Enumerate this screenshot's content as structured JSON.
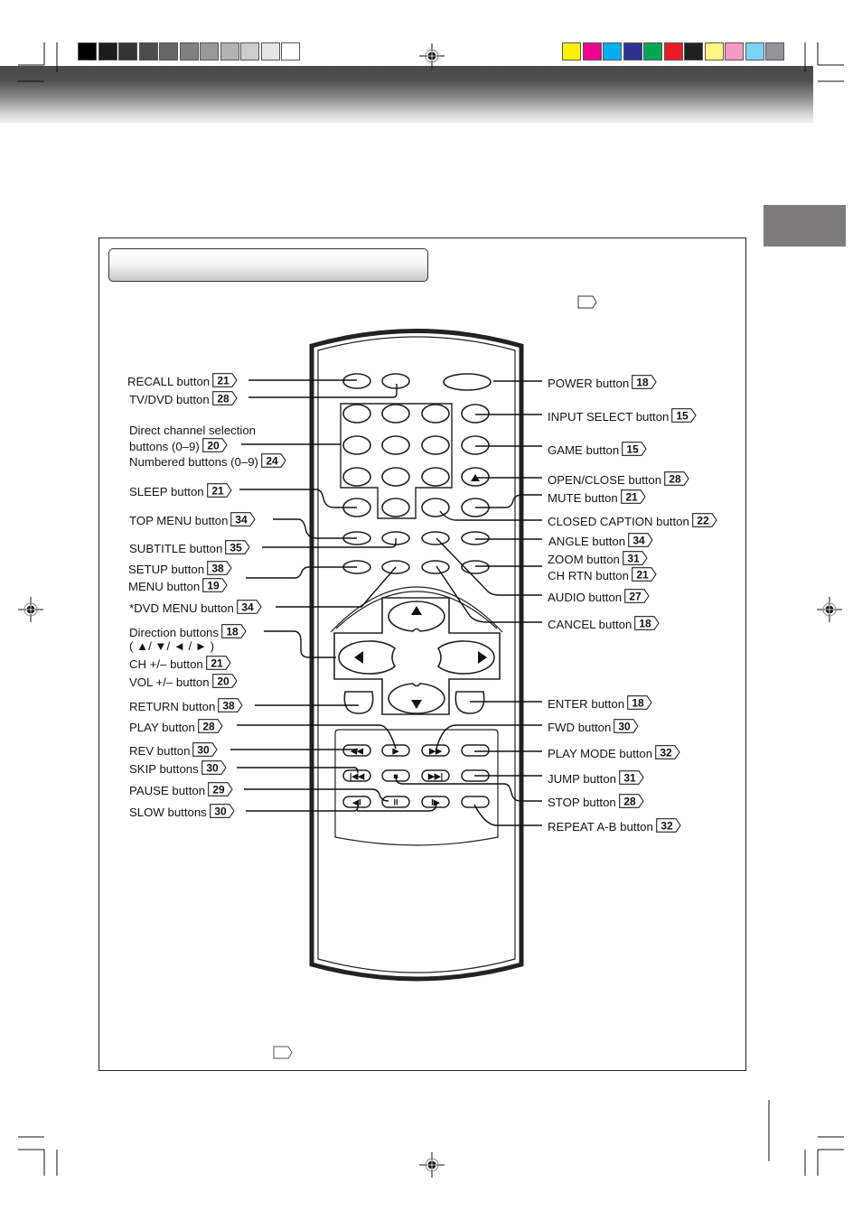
{
  "page": {
    "color_bar_gray": [
      "#000000",
      "#1c1c1c",
      "#353535",
      "#4d4d4d",
      "#666666",
      "#808080",
      "#999999",
      "#b3b3b3",
      "#cccccc",
      "#e6e6e6",
      "#ffffff"
    ],
    "color_bar_color": [
      "#fff200",
      "#ec008c",
      "#00aeef",
      "#2e3192",
      "#00a651",
      "#ed1c24",
      "#231f20",
      "#fff582",
      "#f49ac1",
      "#7dd3f7",
      "#939598"
    ],
    "side_tab_color": "#7d7b7b"
  },
  "labels_left": [
    {
      "id": "recall",
      "text": "RECALL button",
      "page": "21"
    },
    {
      "id": "tvdvd",
      "text": "TV/DVD button",
      "page": "28"
    },
    {
      "id": "direct1",
      "text": "Direct channel selection",
      "page": null
    },
    {
      "id": "direct2",
      "text": "buttons (0–9)",
      "page": "20"
    },
    {
      "id": "numbered",
      "text": "Numbered buttons (0–9)",
      "page": "24"
    },
    {
      "id": "sleep",
      "text": "SLEEP button",
      "page": "21"
    },
    {
      "id": "topmenu",
      "text": "TOP MENU button",
      "page": "34"
    },
    {
      "id": "subtitle",
      "text": "SUBTITLE button",
      "page": "35"
    },
    {
      "id": "setup",
      "text": "SETUP button",
      "page": "38"
    },
    {
      "id": "menu",
      "text": "MENU button",
      "page": "19"
    },
    {
      "id": "dvdmenu",
      "text": "*DVD MENU button",
      "page": "34"
    },
    {
      "id": "direction",
      "text": "Direction buttons",
      "page": "18"
    },
    {
      "id": "arrows",
      "text": "( ▲/ ▼/ ◄ / ► )",
      "page": null
    },
    {
      "id": "ch",
      "text": "CH +/– button",
      "page": "21"
    },
    {
      "id": "vol",
      "text": "VOL +/– button",
      "page": "20"
    },
    {
      "id": "return",
      "text": "RETURN button",
      "page": "38"
    },
    {
      "id": "play",
      "text": "PLAY button",
      "page": "28"
    },
    {
      "id": "rev",
      "text": "REV button",
      "page": "30"
    },
    {
      "id": "skip",
      "text": "SKIP buttons",
      "page": "30"
    },
    {
      "id": "pause",
      "text": "PAUSE button",
      "page": "29"
    },
    {
      "id": "slow",
      "text": "SLOW buttons",
      "page": "30"
    }
  ],
  "labels_right": [
    {
      "id": "power",
      "text": "POWER button",
      "page": "18"
    },
    {
      "id": "inputselect",
      "text": "INPUT SELECT button",
      "page": "15"
    },
    {
      "id": "game",
      "text": "GAME button",
      "page": "15"
    },
    {
      "id": "openclose",
      "text": "OPEN/CLOSE button",
      "page": "28"
    },
    {
      "id": "mute",
      "text": "MUTE button",
      "page": "21"
    },
    {
      "id": "cc",
      "text": "CLOSED CAPTION button",
      "page": "22"
    },
    {
      "id": "angle",
      "text": "ANGLE button",
      "page": "34"
    },
    {
      "id": "zoom",
      "text": "ZOOM button",
      "page": "31"
    },
    {
      "id": "chrtn",
      "text": "CH RTN button",
      "page": "21"
    },
    {
      "id": "audio",
      "text": "AUDIO button",
      "page": "27"
    },
    {
      "id": "cancel",
      "text": "CANCEL button",
      "page": "18"
    },
    {
      "id": "enter",
      "text": "ENTER button",
      "page": "18"
    },
    {
      "id": "fwd",
      "text": "FWD button",
      "page": "30"
    },
    {
      "id": "playmode",
      "text": "PLAY MODE button",
      "page": "32"
    },
    {
      "id": "jump",
      "text": "JUMP button",
      "page": "31"
    },
    {
      "id": "stop",
      "text": "STOP button",
      "page": "28"
    },
    {
      "id": "repeatab",
      "text": "REPEAT A-B button",
      "page": "32"
    }
  ],
  "icons": {
    "up": "▲",
    "down": "▼",
    "left": "◀",
    "right": "▶",
    "eject": "▲",
    "play": "▶",
    "rev": "◀◀",
    "fwd": "▶▶",
    "skip_back": "|◀◀",
    "skip_fwd": "▶▶|",
    "stop": "■",
    "pause": "II",
    "slow_back": "◀I",
    "slow_fwd": "I▶"
  }
}
